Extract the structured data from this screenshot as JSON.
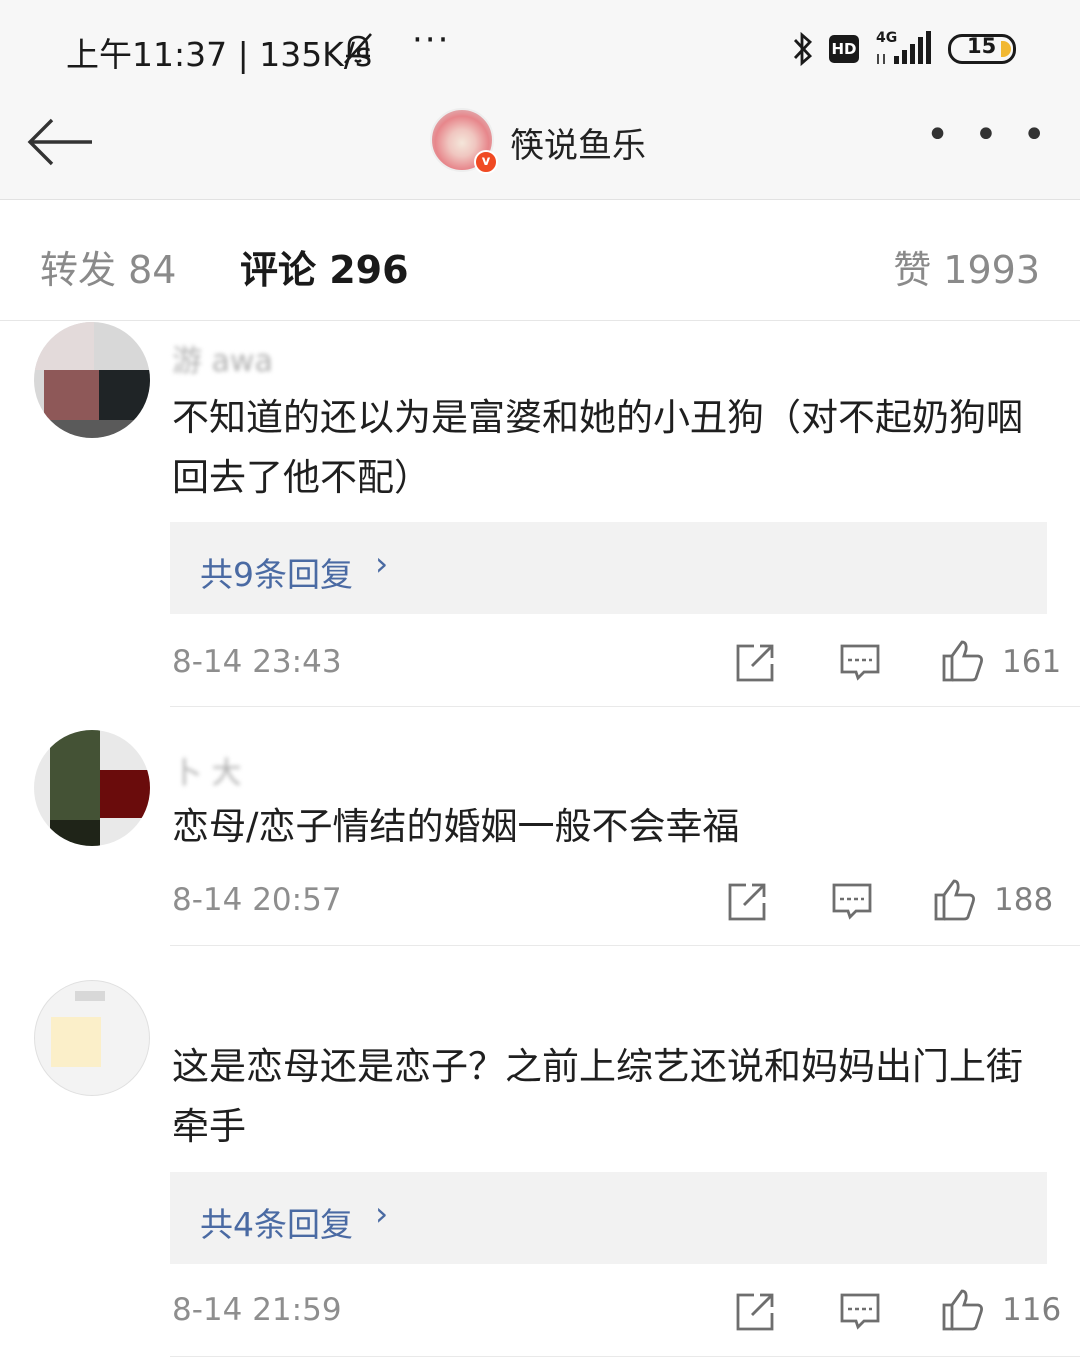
{
  "status_bar": {
    "time_speed": "上午11:37 | 135K/s",
    "more": "···",
    "hd": "HD",
    "network": "4G",
    "battery": "15"
  },
  "header": {
    "author": "筷说鱼乐",
    "verified_badge": "v",
    "more": "• • •"
  },
  "tabs": {
    "repost": "转发 84",
    "comment": "评论 296",
    "like": "赞 1993"
  },
  "comments": [
    {
      "name_fragment": "游 awa",
      "text": "不知道的还以为是富婆和她的小丑狗（对不起奶狗咽回去了他不配）",
      "replies": "共9条回复",
      "time": "8-14 23:43",
      "likes": "161"
    },
    {
      "name_fragment": "卜 大",
      "text": "恋母/恋子情结的婚姻一般不会幸福",
      "time": "8-14 20:57",
      "likes": "188"
    },
    {
      "name_fragment": "",
      "text": "这是恋母还是恋子？之前上综艺还说和妈妈出门上街牵手",
      "replies": "共4条回复",
      "time": "8-14 21:59",
      "likes": "116"
    }
  ],
  "icons": {
    "back": "arrow-left-icon",
    "repost": "share-icon",
    "comment": "comment-icon",
    "like": "thumbs-up-icon",
    "chevron": "chevron-right-icon"
  },
  "colors": {
    "link_blue": "#4a6aa3",
    "verified_orange": "#f04a23",
    "muted_grey": "#8e8e8e"
  }
}
